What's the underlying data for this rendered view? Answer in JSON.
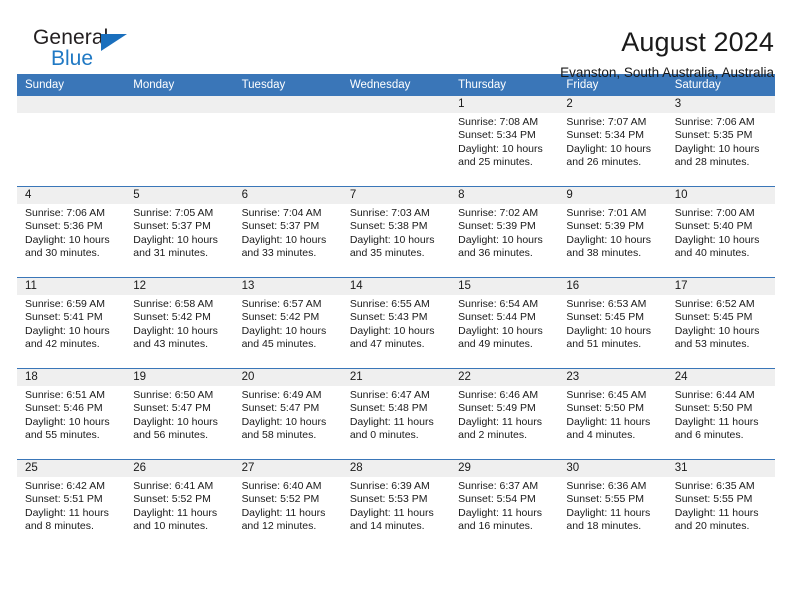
{
  "logo": {
    "line1": "General",
    "line2": "Blue",
    "triangle_icon": "blue-triangle-icon",
    "blue": "#2079c4"
  },
  "header": {
    "title": "August 2024",
    "subtitle": "Evanston, South Australia, Australia"
  },
  "theme": {
    "header_blue": "#3a76b8",
    "day_band_gray": "#efefef",
    "text": "#1a1a1a"
  },
  "calendar": {
    "weekday_headers": [
      "Sunday",
      "Monday",
      "Tuesday",
      "Wednesday",
      "Thursday",
      "Friday",
      "Saturday"
    ],
    "labels": {
      "sunrise": "Sunrise:",
      "sunset": "Sunset:",
      "daylight": "Daylight:"
    },
    "weeks": [
      [
        {
          "day": "",
          "empty": true
        },
        {
          "day": "",
          "empty": true
        },
        {
          "day": "",
          "empty": true
        },
        {
          "day": "",
          "empty": true
        },
        {
          "day": "1",
          "sunrise": "Sunrise: 7:08 AM",
          "sunset": "Sunset: 5:34 PM",
          "daylight1": "Daylight: 10 hours",
          "daylight2": "and 25 minutes."
        },
        {
          "day": "2",
          "sunrise": "Sunrise: 7:07 AM",
          "sunset": "Sunset: 5:34 PM",
          "daylight1": "Daylight: 10 hours",
          "daylight2": "and 26 minutes."
        },
        {
          "day": "3",
          "sunrise": "Sunrise: 7:06 AM",
          "sunset": "Sunset: 5:35 PM",
          "daylight1": "Daylight: 10 hours",
          "daylight2": "and 28 minutes."
        }
      ],
      [
        {
          "day": "4",
          "sunrise": "Sunrise: 7:06 AM",
          "sunset": "Sunset: 5:36 PM",
          "daylight1": "Daylight: 10 hours",
          "daylight2": "and 30 minutes."
        },
        {
          "day": "5",
          "sunrise": "Sunrise: 7:05 AM",
          "sunset": "Sunset: 5:37 PM",
          "daylight1": "Daylight: 10 hours",
          "daylight2": "and 31 minutes."
        },
        {
          "day": "6",
          "sunrise": "Sunrise: 7:04 AM",
          "sunset": "Sunset: 5:37 PM",
          "daylight1": "Daylight: 10 hours",
          "daylight2": "and 33 minutes."
        },
        {
          "day": "7",
          "sunrise": "Sunrise: 7:03 AM",
          "sunset": "Sunset: 5:38 PM",
          "daylight1": "Daylight: 10 hours",
          "daylight2": "and 35 minutes."
        },
        {
          "day": "8",
          "sunrise": "Sunrise: 7:02 AM",
          "sunset": "Sunset: 5:39 PM",
          "daylight1": "Daylight: 10 hours",
          "daylight2": "and 36 minutes."
        },
        {
          "day": "9",
          "sunrise": "Sunrise: 7:01 AM",
          "sunset": "Sunset: 5:39 PM",
          "daylight1": "Daylight: 10 hours",
          "daylight2": "and 38 minutes."
        },
        {
          "day": "10",
          "sunrise": "Sunrise: 7:00 AM",
          "sunset": "Sunset: 5:40 PM",
          "daylight1": "Daylight: 10 hours",
          "daylight2": "and 40 minutes."
        }
      ],
      [
        {
          "day": "11",
          "sunrise": "Sunrise: 6:59 AM",
          "sunset": "Sunset: 5:41 PM",
          "daylight1": "Daylight: 10 hours",
          "daylight2": "and 42 minutes."
        },
        {
          "day": "12",
          "sunrise": "Sunrise: 6:58 AM",
          "sunset": "Sunset: 5:42 PM",
          "daylight1": "Daylight: 10 hours",
          "daylight2": "and 43 minutes."
        },
        {
          "day": "13",
          "sunrise": "Sunrise: 6:57 AM",
          "sunset": "Sunset: 5:42 PM",
          "daylight1": "Daylight: 10 hours",
          "daylight2": "and 45 minutes."
        },
        {
          "day": "14",
          "sunrise": "Sunrise: 6:55 AM",
          "sunset": "Sunset: 5:43 PM",
          "daylight1": "Daylight: 10 hours",
          "daylight2": "and 47 minutes."
        },
        {
          "day": "15",
          "sunrise": "Sunrise: 6:54 AM",
          "sunset": "Sunset: 5:44 PM",
          "daylight1": "Daylight: 10 hours",
          "daylight2": "and 49 minutes."
        },
        {
          "day": "16",
          "sunrise": "Sunrise: 6:53 AM",
          "sunset": "Sunset: 5:45 PM",
          "daylight1": "Daylight: 10 hours",
          "daylight2": "and 51 minutes."
        },
        {
          "day": "17",
          "sunrise": "Sunrise: 6:52 AM",
          "sunset": "Sunset: 5:45 PM",
          "daylight1": "Daylight: 10 hours",
          "daylight2": "and 53 minutes."
        }
      ],
      [
        {
          "day": "18",
          "sunrise": "Sunrise: 6:51 AM",
          "sunset": "Sunset: 5:46 PM",
          "daylight1": "Daylight: 10 hours",
          "daylight2": "and 55 minutes."
        },
        {
          "day": "19",
          "sunrise": "Sunrise: 6:50 AM",
          "sunset": "Sunset: 5:47 PM",
          "daylight1": "Daylight: 10 hours",
          "daylight2": "and 56 minutes."
        },
        {
          "day": "20",
          "sunrise": "Sunrise: 6:49 AM",
          "sunset": "Sunset: 5:47 PM",
          "daylight1": "Daylight: 10 hours",
          "daylight2": "and 58 minutes."
        },
        {
          "day": "21",
          "sunrise": "Sunrise: 6:47 AM",
          "sunset": "Sunset: 5:48 PM",
          "daylight1": "Daylight: 11 hours",
          "daylight2": "and 0 minutes."
        },
        {
          "day": "22",
          "sunrise": "Sunrise: 6:46 AM",
          "sunset": "Sunset: 5:49 PM",
          "daylight1": "Daylight: 11 hours",
          "daylight2": "and 2 minutes."
        },
        {
          "day": "23",
          "sunrise": "Sunrise: 6:45 AM",
          "sunset": "Sunset: 5:50 PM",
          "daylight1": "Daylight: 11 hours",
          "daylight2": "and 4 minutes."
        },
        {
          "day": "24",
          "sunrise": "Sunrise: 6:44 AM",
          "sunset": "Sunset: 5:50 PM",
          "daylight1": "Daylight: 11 hours",
          "daylight2": "and 6 minutes."
        }
      ],
      [
        {
          "day": "25",
          "sunrise": "Sunrise: 6:42 AM",
          "sunset": "Sunset: 5:51 PM",
          "daylight1": "Daylight: 11 hours",
          "daylight2": "and 8 minutes."
        },
        {
          "day": "26",
          "sunrise": "Sunrise: 6:41 AM",
          "sunset": "Sunset: 5:52 PM",
          "daylight1": "Daylight: 11 hours",
          "daylight2": "and 10 minutes."
        },
        {
          "day": "27",
          "sunrise": "Sunrise: 6:40 AM",
          "sunset": "Sunset: 5:52 PM",
          "daylight1": "Daylight: 11 hours",
          "daylight2": "and 12 minutes."
        },
        {
          "day": "28",
          "sunrise": "Sunrise: 6:39 AM",
          "sunset": "Sunset: 5:53 PM",
          "daylight1": "Daylight: 11 hours",
          "daylight2": "and 14 minutes."
        },
        {
          "day": "29",
          "sunrise": "Sunrise: 6:37 AM",
          "sunset": "Sunset: 5:54 PM",
          "daylight1": "Daylight: 11 hours",
          "daylight2": "and 16 minutes."
        },
        {
          "day": "30",
          "sunrise": "Sunrise: 6:36 AM",
          "sunset": "Sunset: 5:55 PM",
          "daylight1": "Daylight: 11 hours",
          "daylight2": "and 18 minutes."
        },
        {
          "day": "31",
          "sunrise": "Sunrise: 6:35 AM",
          "sunset": "Sunset: 5:55 PM",
          "daylight1": "Daylight: 11 hours",
          "daylight2": "and 20 minutes."
        }
      ]
    ]
  }
}
